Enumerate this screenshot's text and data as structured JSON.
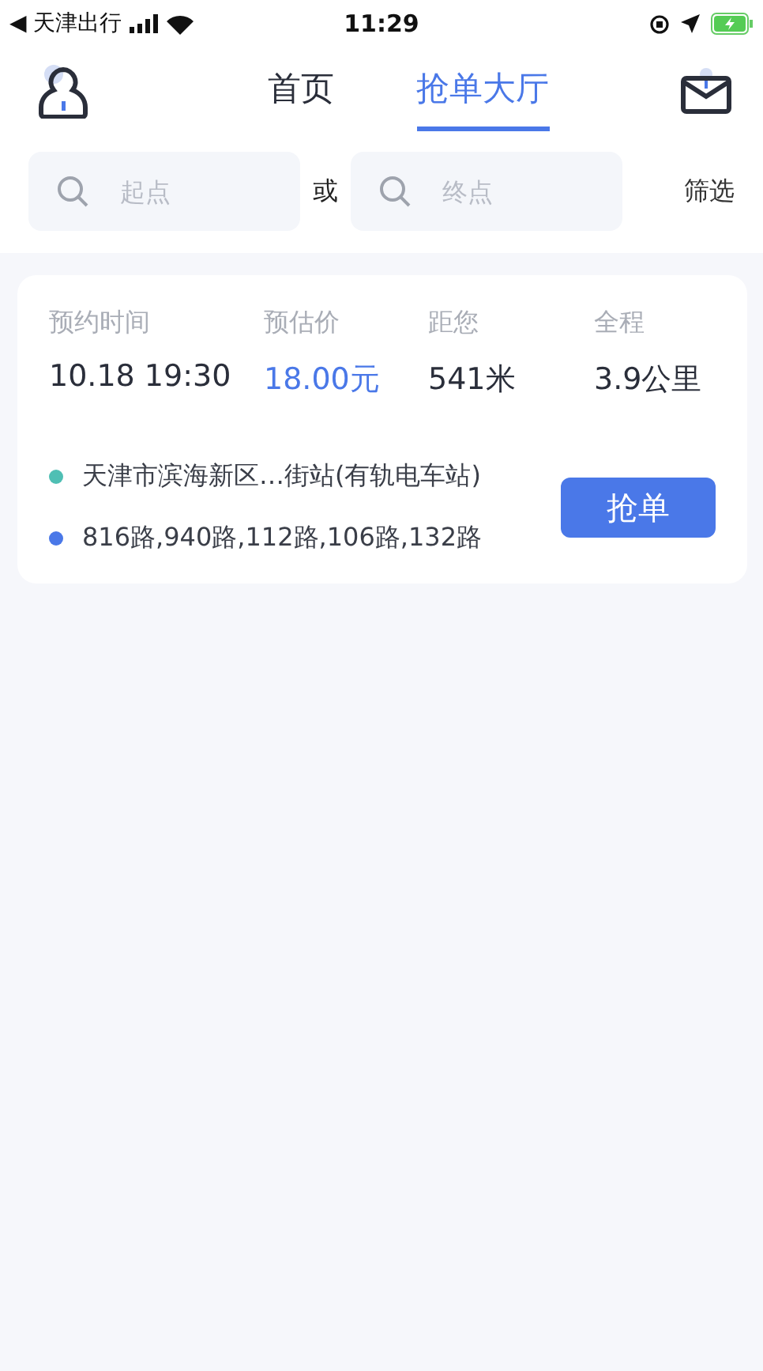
{
  "status_bar": {
    "back_app": "◀ 天津出行",
    "time": "11:29"
  },
  "tabs": [
    {
      "label": "首页",
      "selected": false
    },
    {
      "label": "抢单大厅",
      "selected": true
    }
  ],
  "search": {
    "start_placeholder": "起点",
    "separator": "或",
    "end_placeholder": "终点",
    "filter": "筛选"
  },
  "orders": [
    {
      "stats": [
        {
          "label": "预约时间",
          "value": "10.18 19:30",
          "kind": "plain"
        },
        {
          "label": "预估价",
          "value": "18.00元",
          "kind": "price"
        },
        {
          "label": "距您",
          "value": "541米",
          "kind": "plain"
        },
        {
          "label": "全程",
          "value": "3.9公里",
          "kind": "plain"
        }
      ],
      "stops": [
        {
          "text": "天津市滨海新区…街站(有轨电车站)",
          "color": "#4fbfb4"
        },
        {
          "text": "816路,940路,112路,106路,132路",
          "color": "#4a78e8"
        }
      ],
      "button": "抢单"
    }
  ]
}
